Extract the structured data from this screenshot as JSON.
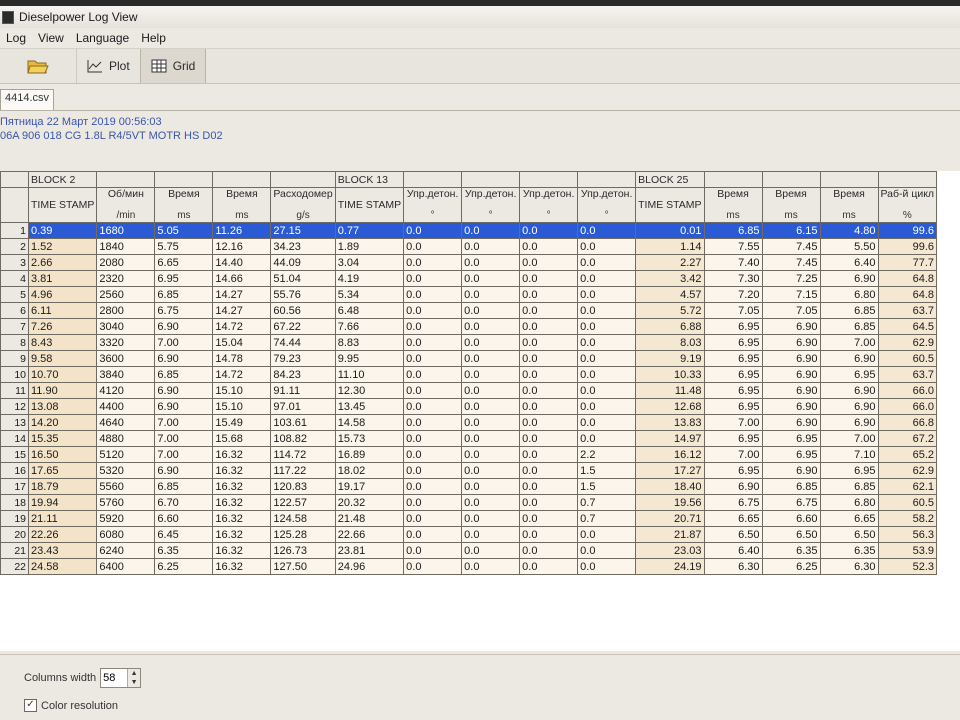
{
  "window": {
    "title": "Dieselpower Log View"
  },
  "menu": [
    "Log",
    "View",
    "Language",
    "Help"
  ],
  "toolbar": {
    "plot_label": "Plot",
    "grid_label": "Grid"
  },
  "file_tab": "4414.csv",
  "info": {
    "date": "Пятница 22 Март 2019 00:56:03",
    "ecu": "06A 906 018 CG  1.8L R4/5VT MOTR HS D02"
  },
  "blocks": {
    "b2": "BLOCK 2",
    "b13": "BLOCK 13",
    "b25": "BLOCK 25"
  },
  "columns": [
    {
      "name": "TIME STAMP",
      "unit": ""
    },
    {
      "name": "Об/мин",
      "unit": "/min"
    },
    {
      "name": "Время",
      "unit": "ms"
    },
    {
      "name": "Время",
      "unit": "ms"
    },
    {
      "name": "Расходомер",
      "unit": "g/s"
    },
    {
      "name": "TIME STAMP",
      "unit": ""
    },
    {
      "name": "Упр.детон.",
      "unit": "°"
    },
    {
      "name": "Упр.детон.",
      "unit": "°"
    },
    {
      "name": "Упр.детон.",
      "unit": "°"
    },
    {
      "name": "Упр.детон.",
      "unit": "°"
    },
    {
      "name": "TIME STAMP",
      "unit": ""
    },
    {
      "name": "Время",
      "unit": "ms"
    },
    {
      "name": "Время",
      "unit": "ms"
    },
    {
      "name": "Время",
      "unit": "ms"
    },
    {
      "name": "Раб-й цикл",
      "unit": "%"
    }
  ],
  "rows": [
    [
      "1",
      "0.39",
      "1680",
      "5.05",
      "11.26",
      "27.15",
      "0.77",
      "0.0",
      "0.0",
      "0.0",
      "0.0",
      "0.01",
      "6.85",
      "6.15",
      "4.80",
      "99.6"
    ],
    [
      "2",
      "1.52",
      "1840",
      "5.75",
      "12.16",
      "34.23",
      "1.89",
      "0.0",
      "0.0",
      "0.0",
      "0.0",
      "1.14",
      "7.55",
      "7.45",
      "5.50",
      "99.6"
    ],
    [
      "3",
      "2.66",
      "2080",
      "6.65",
      "14.40",
      "44.09",
      "3.04",
      "0.0",
      "0.0",
      "0.0",
      "0.0",
      "2.27",
      "7.40",
      "7.45",
      "6.40",
      "77.7"
    ],
    [
      "4",
      "3.81",
      "2320",
      "6.95",
      "14.66",
      "51.04",
      "4.19",
      "0.0",
      "0.0",
      "0.0",
      "0.0",
      "3.42",
      "7.30",
      "7.25",
      "6.90",
      "64.8"
    ],
    [
      "5",
      "4.96",
      "2560",
      "6.85",
      "14.27",
      "55.76",
      "5.34",
      "0.0",
      "0.0",
      "0.0",
      "0.0",
      "4.57",
      "7.20",
      "7.15",
      "6.80",
      "64.8"
    ],
    [
      "6",
      "6.11",
      "2800",
      "6.75",
      "14.27",
      "60.56",
      "6.48",
      "0.0",
      "0.0",
      "0.0",
      "0.0",
      "5.72",
      "7.05",
      "7.05",
      "6.85",
      "63.7"
    ],
    [
      "7",
      "7.26",
      "3040",
      "6.90",
      "14.72",
      "67.22",
      "7.66",
      "0.0",
      "0.0",
      "0.0",
      "0.0",
      "6.88",
      "6.95",
      "6.90",
      "6.85",
      "64.5"
    ],
    [
      "8",
      "8.43",
      "3320",
      "7.00",
      "15.04",
      "74.44",
      "8.83",
      "0.0",
      "0.0",
      "0.0",
      "0.0",
      "8.03",
      "6.95",
      "6.90",
      "7.00",
      "62.9"
    ],
    [
      "9",
      "9.58",
      "3600",
      "6.90",
      "14.78",
      "79.23",
      "9.95",
      "0.0",
      "0.0",
      "0.0",
      "0.0",
      "9.19",
      "6.95",
      "6.90",
      "6.90",
      "60.5"
    ],
    [
      "10",
      "10.70",
      "3840",
      "6.85",
      "14.72",
      "84.23",
      "11.10",
      "0.0",
      "0.0",
      "0.0",
      "0.0",
      "10.33",
      "6.95",
      "6.90",
      "6.95",
      "63.7"
    ],
    [
      "11",
      "11.90",
      "4120",
      "6.90",
      "15.10",
      "91.11",
      "12.30",
      "0.0",
      "0.0",
      "0.0",
      "0.0",
      "11.48",
      "6.95",
      "6.90",
      "6.90",
      "66.0"
    ],
    [
      "12",
      "13.08",
      "4400",
      "6.90",
      "15.10",
      "97.01",
      "13.45",
      "0.0",
      "0.0",
      "0.0",
      "0.0",
      "12.68",
      "6.95",
      "6.90",
      "6.90",
      "66.0"
    ],
    [
      "13",
      "14.20",
      "4640",
      "7.00",
      "15.49",
      "103.61",
      "14.58",
      "0.0",
      "0.0",
      "0.0",
      "0.0",
      "13.83",
      "7.00",
      "6.90",
      "6.90",
      "66.8"
    ],
    [
      "14",
      "15.35",
      "4880",
      "7.00",
      "15.68",
      "108.82",
      "15.73",
      "0.0",
      "0.0",
      "0.0",
      "0.0",
      "14.97",
      "6.95",
      "6.95",
      "7.00",
      "67.2"
    ],
    [
      "15",
      "16.50",
      "5120",
      "7.00",
      "16.32",
      "114.72",
      "16.89",
      "0.0",
      "0.0",
      "0.0",
      "2.2",
      "16.12",
      "7.00",
      "6.95",
      "7.10",
      "65.2"
    ],
    [
      "16",
      "17.65",
      "5320",
      "6.90",
      "16.32",
      "117.22",
      "18.02",
      "0.0",
      "0.0",
      "0.0",
      "1.5",
      "17.27",
      "6.95",
      "6.90",
      "6.95",
      "62.9"
    ],
    [
      "17",
      "18.79",
      "5560",
      "6.85",
      "16.32",
      "120.83",
      "19.17",
      "0.0",
      "0.0",
      "0.0",
      "1.5",
      "18.40",
      "6.90",
      "6.85",
      "6.85",
      "62.1"
    ],
    [
      "18",
      "19.94",
      "5760",
      "6.70",
      "16.32",
      "122.57",
      "20.32",
      "0.0",
      "0.0",
      "0.0",
      "0.7",
      "19.56",
      "6.75",
      "6.75",
      "6.80",
      "60.5"
    ],
    [
      "19",
      "21.11",
      "5920",
      "6.60",
      "16.32",
      "124.58",
      "21.48",
      "0.0",
      "0.0",
      "0.0",
      "0.7",
      "20.71",
      "6.65",
      "6.60",
      "6.65",
      "58.2"
    ],
    [
      "20",
      "22.26",
      "6080",
      "6.45",
      "16.32",
      "125.28",
      "22.66",
      "0.0",
      "0.0",
      "0.0",
      "0.0",
      "21.87",
      "6.50",
      "6.50",
      "6.50",
      "56.3"
    ],
    [
      "21",
      "23.43",
      "6240",
      "6.35",
      "16.32",
      "126.73",
      "23.81",
      "0.0",
      "0.0",
      "0.0",
      "0.0",
      "23.03",
      "6.40",
      "6.35",
      "6.35",
      "53.9"
    ],
    [
      "22",
      "24.58",
      "6400",
      "6.25",
      "16.32",
      "127.50",
      "24.96",
      "0.0",
      "0.0",
      "0.0",
      "0.0",
      "24.19",
      "6.30",
      "6.25",
      "6.30",
      "52.3"
    ]
  ],
  "bottom": {
    "columns_width_label": "Columns width",
    "columns_width_value": "58",
    "color_resolution_label": "Color resolution",
    "color_resolution_checked": true
  }
}
